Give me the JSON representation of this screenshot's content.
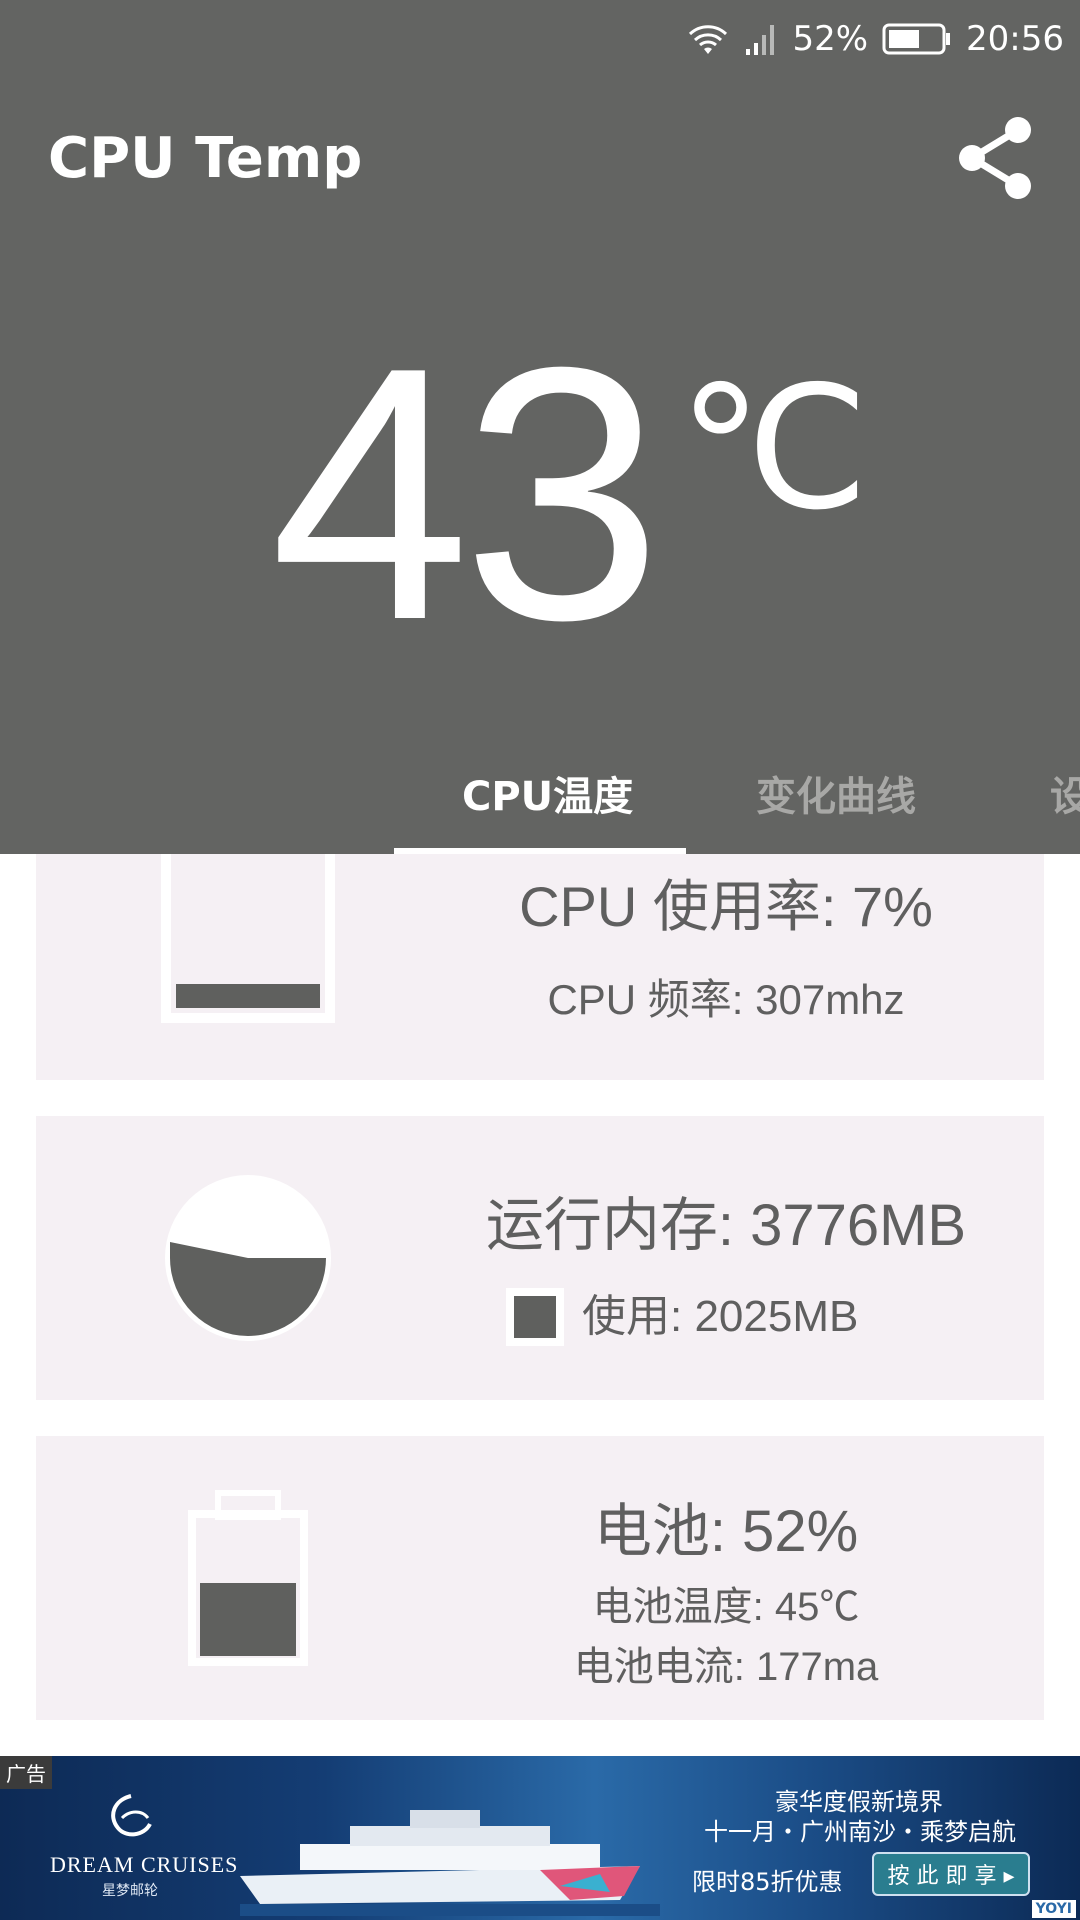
{
  "status_bar": {
    "battery_percent": "52%",
    "time": "20:56"
  },
  "app": {
    "title": "CPU Temp"
  },
  "temperature": {
    "value": "43",
    "unit": "℃"
  },
  "tabs": [
    {
      "label": "CPU温度",
      "active": true
    },
    {
      "label": "变化曲线",
      "active": false
    },
    {
      "label": "设",
      "active": false
    }
  ],
  "cpu_card": {
    "usage_label": "CPU 使用率: 7%",
    "frequency_label": "CPU 频率: 307mhz",
    "usage_fraction": 0.07
  },
  "memory_card": {
    "total_label": "运行内存: 3776MB",
    "used_label": "使用: 2025MB",
    "used_fraction": 0.536
  },
  "battery_card": {
    "level_label": "电池: 52%",
    "temperature_label": "电池温度: 45℃",
    "current_label": "电池电流: 177ma",
    "level_fraction": 0.52
  },
  "ad": {
    "tag": "广告",
    "brand": "DREAM CRUISES",
    "brand_cn": "星梦邮轮",
    "line1": "豪华度假新境界",
    "line2": "十一月・广州南沙・乘梦启航",
    "line3": "限时85折优惠",
    "cta": "按 此 即 享 ▸",
    "badge": "YOYI"
  },
  "colors": {
    "header": "#636462",
    "card": "#f5f0f4",
    "fill": "#5f605e"
  }
}
